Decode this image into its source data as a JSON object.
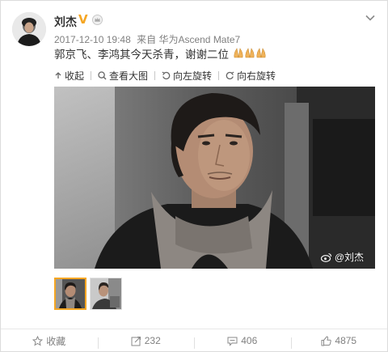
{
  "post": {
    "username": "刘杰",
    "verified_badge": "V",
    "verified_color": "#f5a623",
    "timestamp": "2017-12-10 19:48",
    "source_prefix": "来自",
    "source": "华为Ascend Mate7",
    "text": "郭京飞、李鸿其今天杀青，谢谢二位",
    "emoji": "🙏🙏🙏",
    "emoji_name": "pray-emoji"
  },
  "media_toolbar": {
    "collapse": "收起",
    "view_large": "查看大图",
    "rotate_left": "向左旋转",
    "rotate_right": "向右旋转"
  },
  "photo": {
    "watermark": "@刘杰",
    "thumbnails": [
      {
        "name": "thumbnail-1",
        "selected": true
      },
      {
        "name": "thumbnail-2",
        "selected": false
      }
    ]
  },
  "footer": {
    "favorite": "收藏",
    "repost_count": "232",
    "comment_count": "406",
    "like_count": "4875"
  },
  "icons": {
    "more": "chevron-down-icon",
    "member": "member-crown-icon",
    "collapse": "collapse-up-icon",
    "zoom": "search-icon",
    "rotate_left": "rotate-left-icon",
    "rotate_right": "rotate-right-icon",
    "favorite": "star-icon",
    "repost": "repost-icon",
    "comment": "comment-icon",
    "like": "thumbs-up-icon"
  },
  "colors": {
    "accent": "#f5a623",
    "text_primary": "#333333",
    "text_secondary": "#808080",
    "link_blue": "#eb7350"
  }
}
